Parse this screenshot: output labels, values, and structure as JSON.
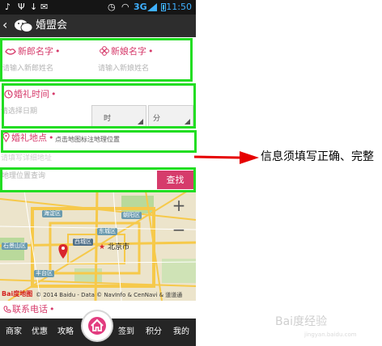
{
  "status_bar": {
    "time": "11:50",
    "network": "3G",
    "icons": [
      "usb-icon",
      "download-icon",
      "mail-icon",
      "alarm-icon",
      "wifi-icon",
      "signal-icon",
      "battery-icon"
    ]
  },
  "header": {
    "back_glyph": "‹",
    "title": "婚盟会",
    "logo_icon": "wechat-icon"
  },
  "form": {
    "groom": {
      "label": "新郎名字",
      "required": "•",
      "placeholder": "请输入新郎姓名",
      "icon": "lips-icon"
    },
    "bride": {
      "label": "新娘名字",
      "required": "•",
      "placeholder": "请输入新娘姓名",
      "icon": "flower-icon"
    },
    "time": {
      "label": "婚礼时间",
      "required": "•",
      "date_placeholder": "请选择日期",
      "hour_label": "时",
      "minute_label": "分",
      "icon": "clock-icon"
    },
    "location": {
      "label": "婚礼地点",
      "required": "•",
      "hint": "点击地图标注地理位置",
      "address_placeholder": "请填写详细地址",
      "icon": "location-pin-icon"
    },
    "search": {
      "placeholder": "地理位置查询",
      "button_label": "查找"
    },
    "phone": {
      "label": "联系电话",
      "required": "•",
      "icon": "phone-icon"
    }
  },
  "map": {
    "labels": [
      "海淀区",
      "朝阳区",
      "东城区",
      "西城区",
      "石景山区",
      "丰台区"
    ],
    "city_label": "北京市",
    "zoom_in": "+",
    "zoom_out": "−",
    "logo_text": "Bai度地图",
    "copyright": "© 2014 Baidu - Data © NavInfo & CenNavi & 道道通",
    "colors": {
      "land": "#ece4cb",
      "main_road": "#f6c94a",
      "green": "#b9d99b",
      "marker": "#d9262d"
    }
  },
  "bottom_nav": {
    "items": [
      "商家",
      "优惠",
      "攻略",
      "签到",
      "积分",
      "我的"
    ],
    "home_icon": "home-icon",
    "accent": "#e23c7f"
  },
  "annotation": {
    "text": "信息须填写正确、完整",
    "highlight_color": "#22dd22",
    "arrow_color": "#e60000"
  },
  "watermark": {
    "text": "Bai度经验",
    "subtext": "jingyan.baidu.com"
  }
}
